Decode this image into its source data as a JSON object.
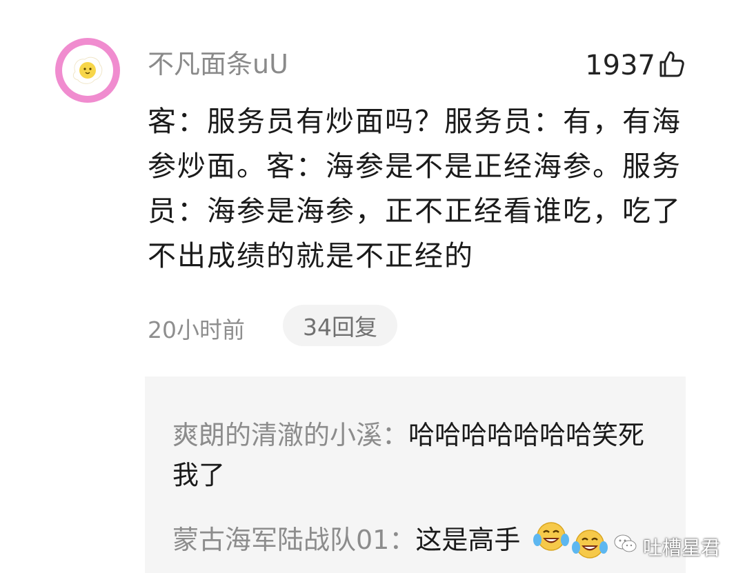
{
  "comment": {
    "username": "不凡面条uU",
    "like_count": "1937",
    "text": "客：服务员有炒面吗？服务员：有，有海参炒面。客：海参是不是正经海参。服务员：海参是海参，正不正经看谁吃，吃了不出成绩的就是不正经的",
    "time": "20小时前",
    "reply_count_label": "34回复"
  },
  "replies": [
    {
      "author": "爽朗的清澈的小溪",
      "separator": "：",
      "content": "哈哈哈哈哈哈哈笑死我了"
    },
    {
      "author": "蒙古海军陆战队01",
      "separator": "：",
      "content": "这是高手"
    }
  ],
  "watermark": {
    "label": "吐槽星君"
  },
  "icons": {
    "avatar": "fried-egg-avatar-icon",
    "like": "thumbs-up-icon",
    "emoji_1": "laughing-tears-emoji-icon",
    "emoji_2": "laughing-tears-emoji-icon",
    "watermark": "wechat-icon"
  },
  "colors": {
    "avatar_ring": "#f08ccf",
    "reply_background": "#f5f5f5",
    "username": "#8a8a8a",
    "body_text": "#1a1a1a"
  }
}
